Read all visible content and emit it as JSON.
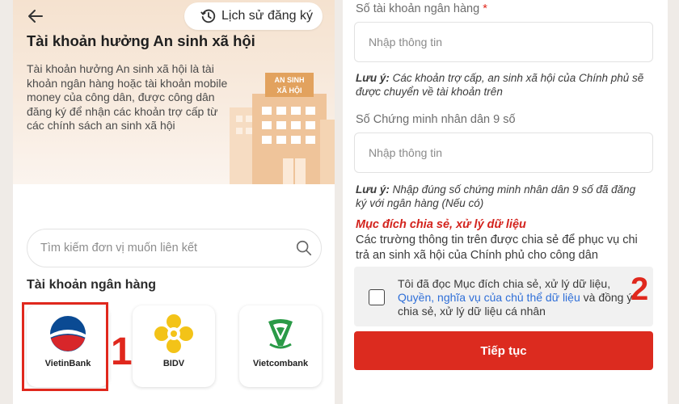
{
  "left": {
    "history_button": "Lịch sử đăng ký",
    "title": "Tài khoản hưởng An sinh xã hội",
    "description": "Tài khoản hưởng An sinh xã hội là tài khoản ngân hàng hoặc tài khoản mobile money của công dân, được công dân đăng ký để nhận các khoản trợ cấp từ các chính sách an sinh xã hội",
    "building_sign_line1": "AN SINH",
    "building_sign_line2": "XÃ HỘI",
    "search_placeholder": "Tìm kiếm đơn vị muốn liên kết",
    "section_title": "Tài khoản ngân hàng",
    "banks": [
      {
        "name": "VietinBank",
        "icon": "vietinbank-logo-icon"
      },
      {
        "name": "BIDV",
        "icon": "bidv-logo-icon"
      },
      {
        "name": "Vietcombank",
        "icon": "vietcombank-logo-icon"
      }
    ],
    "marker": "1"
  },
  "right": {
    "account_label": "Số tài khoản ngân hàng",
    "required_mark": "*",
    "account_placeholder": "Nhập thông tin",
    "note1_prefix": "Lưu ý:",
    "note1_text": "Các khoản trợ cấp, an sinh xã hội của Chính phủ sẽ được chuyển về tài khoản trên",
    "id_label": "Số Chứng minh nhân dân 9 số",
    "id_placeholder": "Nhập thông tin",
    "note2_prefix": "Lưu ý:",
    "note2_text": "Nhập đúng số chứng minh nhân dân 9 số đã đăng ký với ngân hàng (Nếu có)",
    "purpose_title": "Mục đích chia sẻ, xử lý dữ liệu",
    "purpose_text": "Các trường thông tin trên được chia sẻ để phục vụ chi trả an sinh xã hội của Chính phủ cho công dân",
    "consent_part1": "Tôi đã đọc Mục đích chia sẻ, xử lý dữ liệu,",
    "consent_link": "Quyền, nghĩa vụ của chủ thể dữ liệu",
    "consent_part2": "và đồng ý chia sẻ, xử lý dữ liệu cá nhân",
    "submit_label": "Tiếp tục",
    "marker": "2"
  },
  "colors": {
    "accent_red": "#dc2b1f",
    "link_blue": "#2f6fd8",
    "hero_bg": "#f5e2cf"
  }
}
